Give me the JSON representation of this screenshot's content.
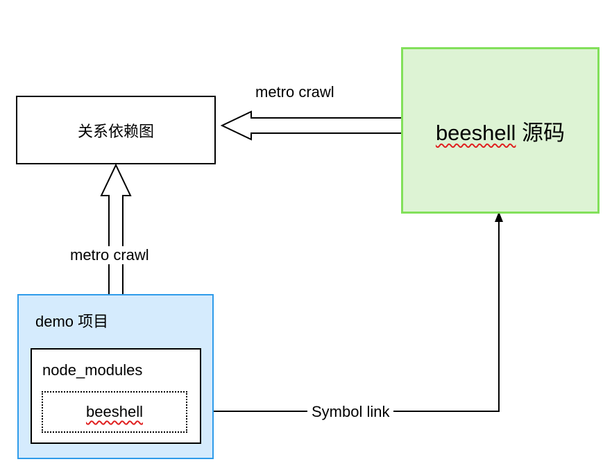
{
  "nodes": {
    "dependency_graph": "关系依赖图",
    "source": {
      "name": "beeshell",
      "suffix": "源码"
    },
    "demo_project": "demo 项目",
    "node_modules": "node_modules",
    "package": "beeshell"
  },
  "edges": {
    "source_to_graph": "metro crawl",
    "demo_to_graph": "metro crawl",
    "package_to_source": "Symbol link"
  },
  "colors": {
    "source_fill": "#ddf3d4",
    "source_border": "#82e05a",
    "demo_fill": "#d5ebfd",
    "demo_border": "#2e9bea",
    "spellcheck_underline": "#e02020"
  }
}
